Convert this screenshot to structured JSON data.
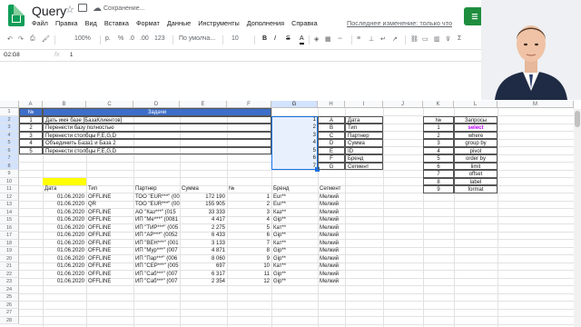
{
  "header": {
    "doc_title": "Query",
    "saving_text": "Сохранение...",
    "last_edit": "Последнее изменение: только что",
    "share_label": "☰"
  },
  "menu": [
    "Файл",
    "Правка",
    "Вид",
    "Вставка",
    "Формат",
    "Данные",
    "Инструменты",
    "Дополнения",
    "Справка"
  ],
  "toolbar": {
    "zoom": "100%",
    "currency": "р.",
    "percent": "%",
    "dec_less": ".0",
    "dec_more": ".00",
    "more_formats": "123",
    "font": "По умолча...",
    "font_size": "10",
    "bold": "B",
    "italic": "I",
    "strike": "S",
    "text_color": "A"
  },
  "formula_bar": {
    "name_box": "G2:G8",
    "fx": "fx",
    "value": "1"
  },
  "columns": [
    "A",
    "B",
    "C",
    "D",
    "E",
    "F",
    "G",
    "H",
    "I",
    "J",
    "K",
    "L",
    "M"
  ],
  "rows": [
    "1",
    "2",
    "3",
    "4",
    "5",
    "6",
    "7",
    "8",
    "9",
    "10",
    "11",
    "12",
    "13",
    "14",
    "15",
    "16",
    "17",
    "18",
    "19",
    "20",
    "21",
    "22",
    "23",
    "24",
    "25",
    "26",
    "27",
    "28"
  ],
  "tasks": {
    "num_header": "№",
    "title_header": "Задачи",
    "items": [
      {
        "n": "1",
        "text": "Дать имя базе [БазаКлиентов]"
      },
      {
        "n": "2",
        "text": "Перенести базу полностью"
      },
      {
        "n": "3",
        "text": "Перенести столбцы F,E,G,D"
      },
      {
        "n": "4",
        "text": "Объединить База1 и База 2"
      },
      {
        "n": "5",
        "text": "Перенести столбцы F,E,G,D"
      }
    ]
  },
  "mapping": [
    {
      "num": "1",
      "letter": "A",
      "field": "Дата"
    },
    {
      "num": "2",
      "letter": "B",
      "field": "Тип"
    },
    {
      "num": "3",
      "letter": "C",
      "field": "Партнер"
    },
    {
      "num": "4",
      "letter": "D",
      "field": "Сумма"
    },
    {
      "num": "5",
      "letter": "E",
      "field": "ID"
    },
    {
      "num": "6",
      "letter": "F",
      "field": "Бренд"
    },
    {
      "num": "7",
      "letter": "G",
      "field": "Сегмент"
    }
  ],
  "queries": {
    "num_header": "№",
    "title_header": "Запросы",
    "items": [
      {
        "n": "1",
        "q": "select"
      },
      {
        "n": "2",
        "q": "where"
      },
      {
        "n": "3",
        "q": "group by"
      },
      {
        "n": "4",
        "q": "pivot"
      },
      {
        "n": "5",
        "q": "order by"
      },
      {
        "n": "6",
        "q": "limit"
      },
      {
        "n": "7",
        "q": "offset"
      },
      {
        "n": "8",
        "q": "label"
      },
      {
        "n": "9",
        "q": "format"
      }
    ],
    "highlight_color": "#c000ff"
  },
  "data_table": {
    "headers": [
      "Дата",
      "Тип",
      "Партнер",
      "Сумма",
      "№",
      "Бренд",
      "Сегмент"
    ],
    "rows": [
      [
        "01.06.2020",
        "OFFLINE",
        "ТОО \"EUR***\" (00",
        "172 190",
        "1",
        "Eur**",
        "Мелкий"
      ],
      [
        "01.06.2020",
        "QR",
        "ТОО \"EUR***\" (00",
        "155 905",
        "2",
        "Eur**",
        "Мелкий"
      ],
      [
        "01.06.2020",
        "OFFLINE",
        "АО \"Каз***\" (015",
        "33 333",
        "3",
        "Каз**",
        "Мелкий"
      ],
      [
        "01.06.2020",
        "OFFLINE",
        "ИП \"Ме***\" (0081",
        "4 417",
        "4",
        "Gip**",
        "Мелкий"
      ],
      [
        "01.06.2020",
        "OFFLINE",
        "ИП \"ТИР***\" (005",
        "2 275",
        "5",
        "Кат**",
        "Мелкий"
      ],
      [
        "01.06.2020",
        "OFFLINE",
        "ИП \"АР***\" (0052",
        "6 433",
        "6",
        "Gip**",
        "Мелкий"
      ],
      [
        "01.06.2020",
        "OFFLINE",
        "ИП \"ВЕН***\" (001",
        "3 133",
        "7",
        "Кат**",
        "Мелкий"
      ],
      [
        "01.06.2020",
        "OFFLINE",
        "ИП \"Мур***\" (007",
        "4 871",
        "8",
        "Gip**",
        "Мелкий"
      ],
      [
        "01.06.2020",
        "OFFLINE",
        "ИП \"Пар***\" (006",
        "8 060",
        "9",
        "Gip**",
        "Мелкий"
      ],
      [
        "01.06.2020",
        "OFFLINE",
        "ИП \"СЕР***\" (005",
        "697",
        "10",
        "Кат**",
        "Мелкий"
      ],
      [
        "01.06.2020",
        "OFFLINE",
        "ИП \"Саб***\" (007",
        "6 317",
        "11",
        "Gip**",
        "Мелкий"
      ],
      [
        "01.06.2020",
        "OFFLINE",
        "ИП \"Саб***\" (007",
        "2 354",
        "12",
        "Gip**",
        "Мелкий"
      ]
    ]
  },
  "colors": {
    "selection": "#e8f0fe",
    "selection_border": "#1a73e8",
    "task_header": "#3d6ec9",
    "yellow": "#ffff00",
    "logo_green": "#0f9d58"
  }
}
